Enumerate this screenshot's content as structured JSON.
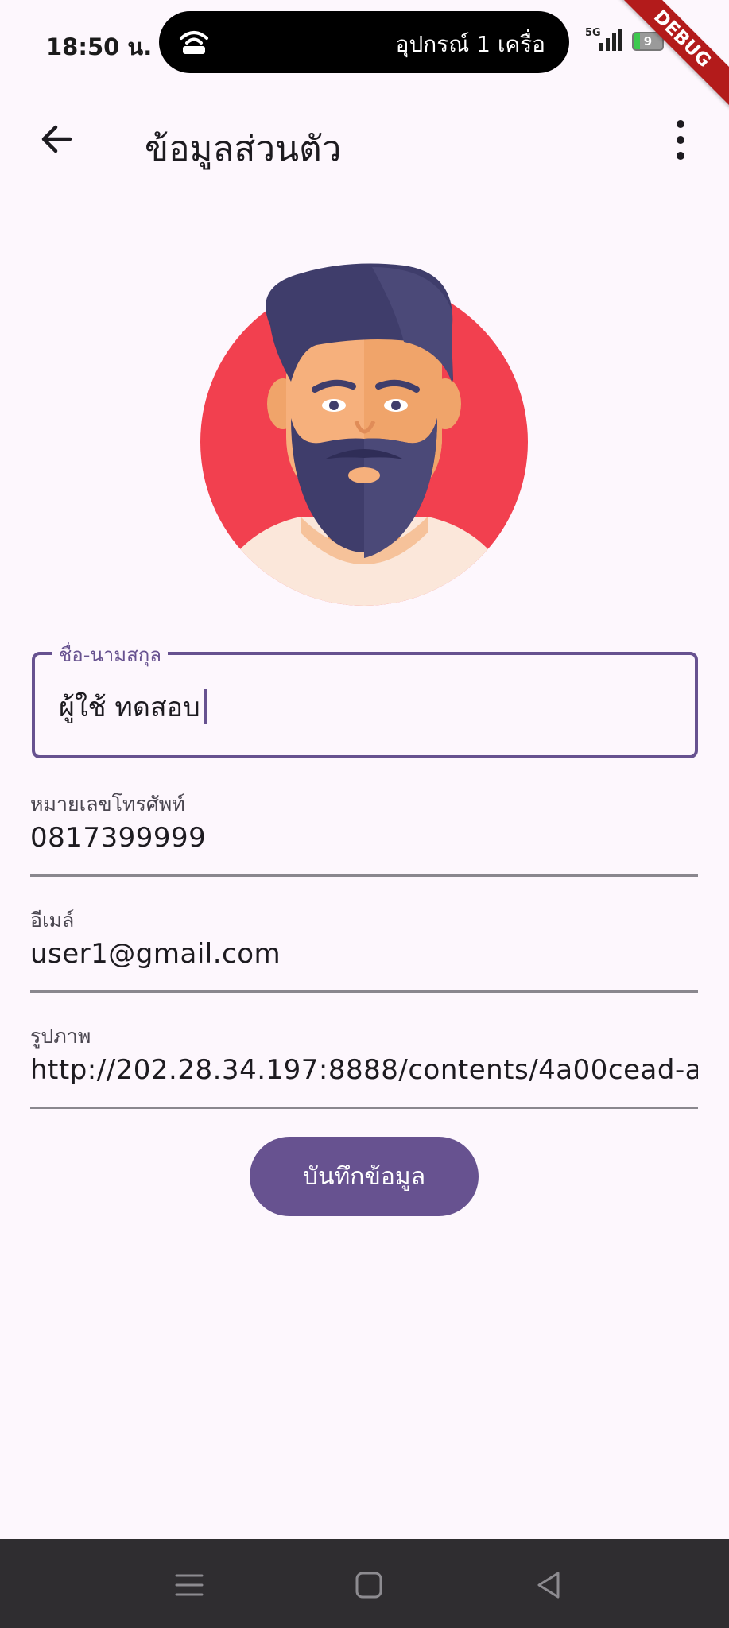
{
  "status_bar": {
    "time": "18:50 น.",
    "hotspot_text": "อุปกรณ์ 1 เครื่อ",
    "network": "5G",
    "battery": "9",
    "debug_banner": "DEBUG"
  },
  "appbar": {
    "title": "ข้อมูลส่วนตัว",
    "back_icon": "arrow-back-icon",
    "menu_icon": "more-vert-icon"
  },
  "form": {
    "name": {
      "label": "ชื่อ-นามสกุล",
      "value": "ผู้ใช้ ทดสอบ"
    },
    "phone": {
      "label": "หมายเลขโทรศัพท์",
      "value": "0817399999"
    },
    "email": {
      "label": "อีเมล์",
      "value": "user1@gmail.com"
    },
    "image": {
      "label": "รูปภาพ",
      "value": "http://202.28.34.197:8888/contents/4a00cead-a"
    }
  },
  "save_button": {
    "label": "บันทึกข้อมูล"
  },
  "colors": {
    "primary": "#675290",
    "background": "#fdf7fd",
    "avatar_circle": "#f2404f"
  }
}
